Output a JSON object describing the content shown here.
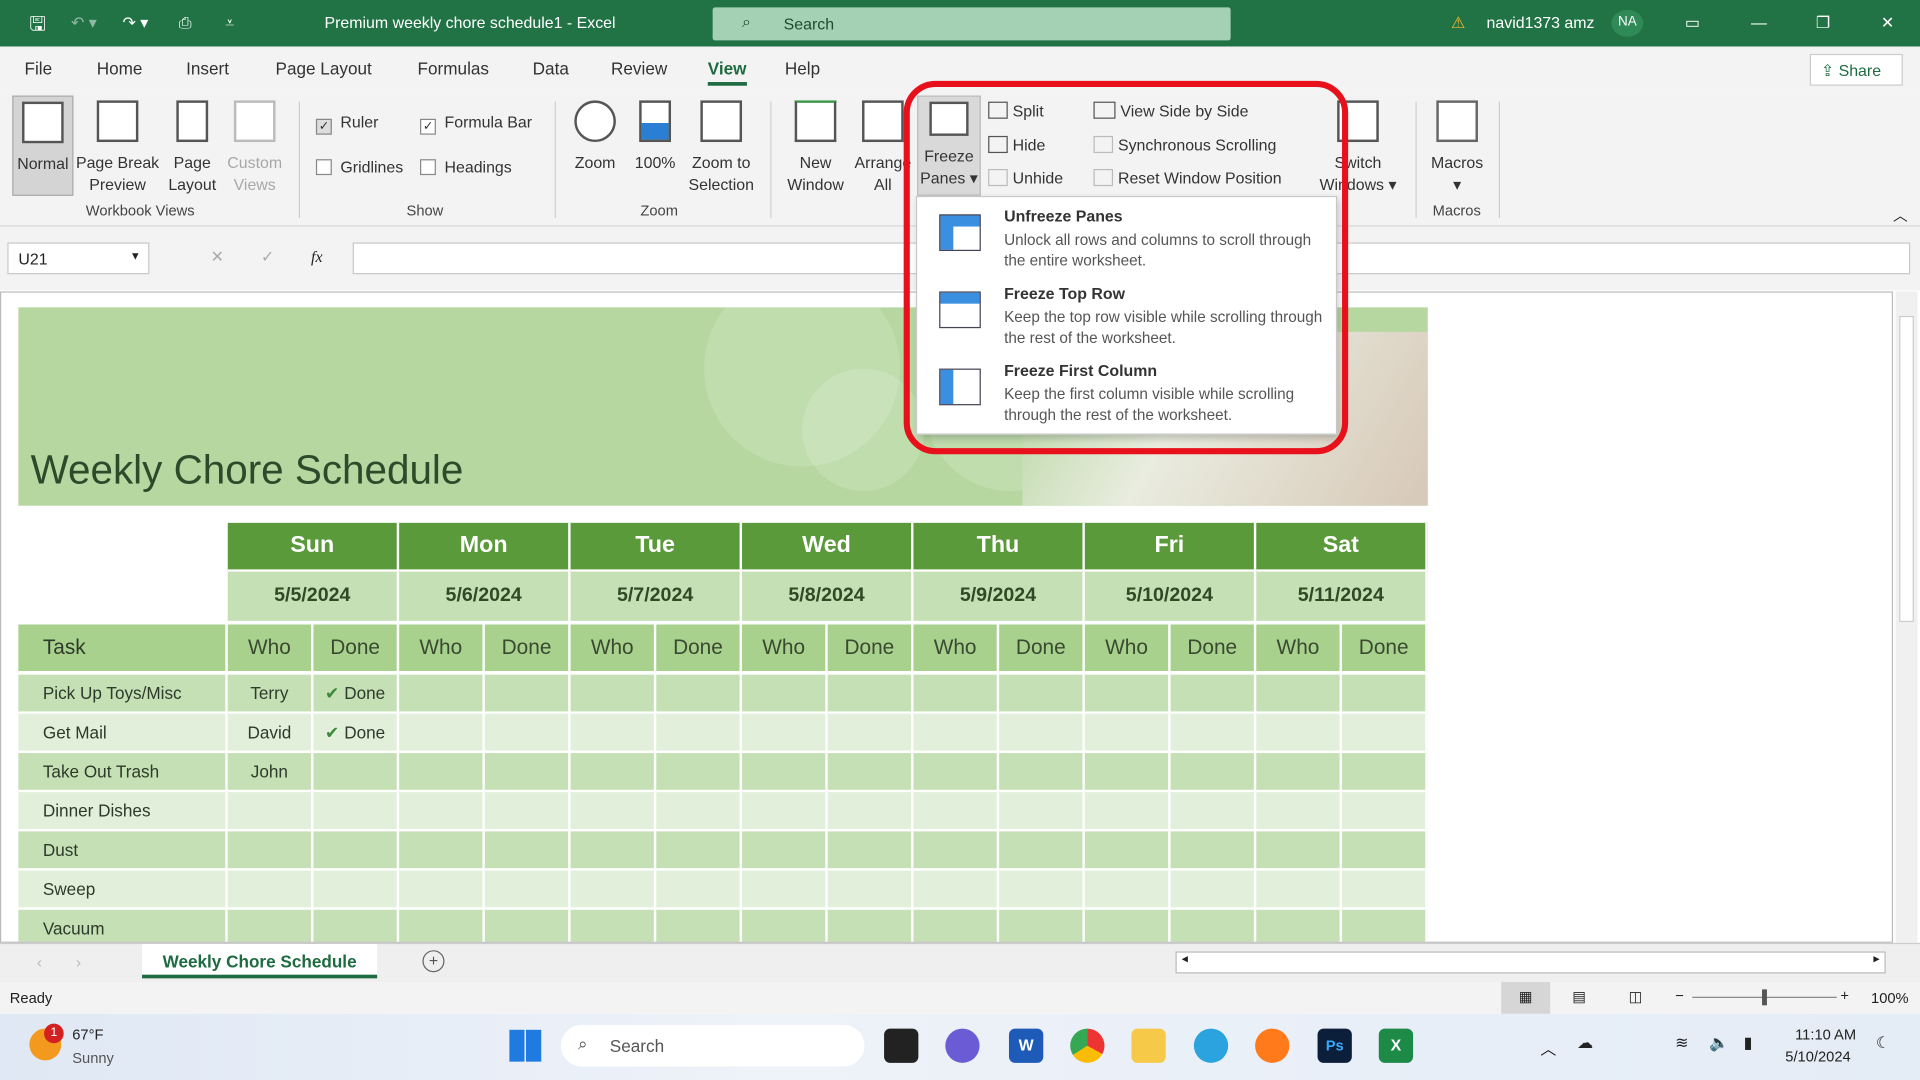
{
  "window": {
    "title": "Premium weekly chore schedule1  -  Excel",
    "search_placeholder": "Search",
    "user": "navid1373 amz",
    "avatar": "NA",
    "share": "Share",
    "accent": "#217346"
  },
  "menu": {
    "tabs": [
      "File",
      "Home",
      "Insert",
      "Page Layout",
      "Formulas",
      "Data",
      "Review",
      "View",
      "Help"
    ],
    "active": "View"
  },
  "ribbon": {
    "workbook_views": {
      "label": "Workbook Views",
      "items": [
        "Normal",
        "Page Break Preview",
        "Page Layout",
        "Custom Views"
      ]
    },
    "show": {
      "label": "Show",
      "ruler": "Ruler",
      "formula_bar": "Formula Bar",
      "gridlines": "Gridlines",
      "headings": "Headings"
    },
    "zoom": {
      "label": "Zoom",
      "items": [
        "Zoom",
        "100%",
        "Zoom to Selection"
      ]
    },
    "window": {
      "new_window": "New Window",
      "arrange_all": "Arrange All",
      "freeze_panes": "Freeze Panes",
      "split": "Split",
      "hide": "Hide",
      "unhide": "Unhide",
      "view_side": "View Side by Side",
      "sync_scroll": "Synchronous Scrolling",
      "reset_pos": "Reset Window Position",
      "switch": "Switch Windows"
    },
    "macros": {
      "label": "Macros",
      "button": "Macros"
    }
  },
  "freeze_menu": [
    {
      "title": "Unfreeze Panes",
      "desc": "Unlock all rows and columns to scroll through the entire worksheet."
    },
    {
      "title": "Freeze Top Row",
      "desc": "Keep the top row visible while scrolling through the rest of the worksheet."
    },
    {
      "title": "Freeze First Column",
      "desc": "Keep the first column visible while scrolling through the rest of the worksheet."
    }
  ],
  "formula_bar": {
    "name_box": "U21",
    "fx": "fx",
    "value": ""
  },
  "sheet": {
    "title": "Weekly Chore Schedule",
    "task_header": "Task",
    "who": "Who",
    "done": "Done",
    "days": [
      {
        "day": "Sun",
        "date": "5/5/2024"
      },
      {
        "day": "Mon",
        "date": "5/6/2024"
      },
      {
        "day": "Tue",
        "date": "5/7/2024"
      },
      {
        "day": "Wed",
        "date": "5/8/2024"
      },
      {
        "day": "Thu",
        "date": "5/9/2024"
      },
      {
        "day": "Fri",
        "date": "5/10/2024"
      },
      {
        "day": "Sat",
        "date": "5/11/2024"
      }
    ],
    "rows": [
      {
        "task": "Pick Up Toys/Misc",
        "sun_who": "Terry",
        "sun_done": "Done"
      },
      {
        "task": "Get Mail",
        "sun_who": "David",
        "sun_done": "Done"
      },
      {
        "task": "Take Out Trash",
        "sun_who": "John",
        "sun_done": ""
      },
      {
        "task": "Dinner Dishes",
        "sun_who": "",
        "sun_done": ""
      },
      {
        "task": "Dust",
        "sun_who": "",
        "sun_done": ""
      },
      {
        "task": "Sweep",
        "sun_who": "",
        "sun_done": ""
      },
      {
        "task": "Vacuum",
        "sun_who": "",
        "sun_done": ""
      }
    ]
  },
  "sheet_tabs": {
    "active": "Weekly Chore Schedule"
  },
  "status": {
    "text": "Ready",
    "zoom": "100%"
  },
  "taskbar": {
    "temp": "67°F",
    "weather": "Sunny",
    "badge": "1",
    "search": "Search",
    "time": "11:10 AM",
    "date": "5/10/2024",
    "word": "W",
    "ps": "Ps",
    "excel": "X"
  }
}
